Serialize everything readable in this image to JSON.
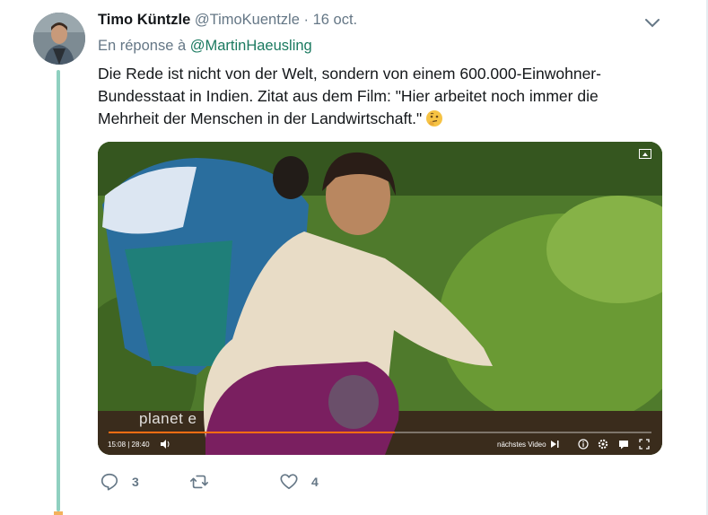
{
  "tweet": {
    "author_name": "Timo Küntzle",
    "author_handle": "@TimoKuentzle",
    "separator": "·",
    "date": "16 oct.",
    "reply_prefix": "En réponse à",
    "reply_to": "@MartinHaeusling",
    "text": "Die Rede ist nicht von der Welt, sondern von einem 600.000-Einwohner-Bundesstaat in Indien. Zitat aus dem Film: \"Hier arbeitet noch immer die Mehrheit der Menschen in der Landwirtschaft.\"",
    "emoji": "thinking-face-icon"
  },
  "video": {
    "watermark": "planet e",
    "time": "15:08 | 28:40",
    "next_label": "nächstes Video",
    "progress_fraction": 0.527
  },
  "actions": {
    "reply_count": "3",
    "retweet_count": "",
    "like_count": "4"
  },
  "colors": {
    "thread_line": "#8fd0c0",
    "reply_link": "#1b7a60",
    "progress": "#ff6d12"
  }
}
